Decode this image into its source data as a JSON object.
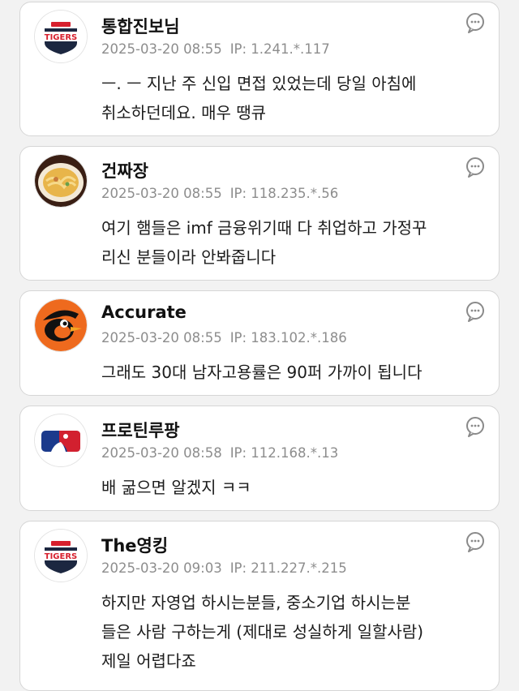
{
  "comments": [
    {
      "nickname": "통합진보님",
      "date": "2025-03-20 08:55",
      "ip": "IP: 1.241.*.117",
      "avatar_icon": "tigers-logo-icon",
      "avatar_text": "TIGERS",
      "lines": [
        "ㅡ. ㅡ 지난 주 신입 면접 있었는데 당일 아침에",
        "취소하던데요. 매우 땡큐"
      ]
    },
    {
      "nickname": "건짜장",
      "date": "2025-03-20 08:55",
      "ip": "IP: 118.235.*.56",
      "avatar_icon": "food-bowl-icon",
      "lines": [
        "여기 햄들은 imf 금융위기때 다 취업하고 가정꾸",
        "리신 분들이라 안봐줍니다"
      ]
    },
    {
      "nickname": "Accurate",
      "date": "2025-03-20 08:55",
      "ip": "IP: 183.102.*.186",
      "avatar_icon": "orioles-bird-icon",
      "lines": [
        "그래도 30대 남자고용률은 90퍼 가까이 됩니다"
      ]
    },
    {
      "nickname": "프로틴루팡",
      "date": "2025-03-20 08:58",
      "ip": "IP: 112.168.*.13",
      "avatar_icon": "mlb-logo-icon",
      "lines": [
        "배 굶으면 알겠지 ㅋㅋ"
      ]
    },
    {
      "nickname": "The영킹",
      "date": "2025-03-20 09:03",
      "ip": "IP: 211.227.*.215",
      "avatar_icon": "tigers-logo-icon",
      "avatar_text": "TIGERS",
      "lines": [
        "하지만 자영업 하시는분들, 중소기업 하시는분",
        "들은 사람 구하는게 (제대로 성실하게 일할사람)",
        "제일 어렵다죠"
      ]
    }
  ],
  "more_icon": "more-bubble-icon",
  "colors": {
    "tigers_red": "#d71f2d",
    "tigers_navy": "#1c2740",
    "orioles_orange": "#ee6a1e",
    "mlb_blue": "#1b3a8c",
    "mlb_red": "#d2202f"
  }
}
